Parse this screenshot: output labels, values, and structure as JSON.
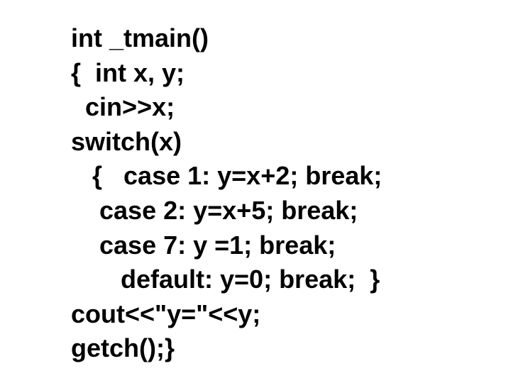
{
  "code": {
    "line1": "int _tmain()",
    "line2": "{  int x, y;",
    "line3": "  cin>>x;",
    "line4": "switch(x)",
    "line5": "   {   case 1: y=x+2; break;",
    "line6": "    case 2: y=x+5; break;",
    "line7": "    case 7: y =1; break;",
    "line8": "       default: y=0; break;  }",
    "line9": "cout<<\"y=\"<<y;",
    "line10": "getch();}"
  }
}
